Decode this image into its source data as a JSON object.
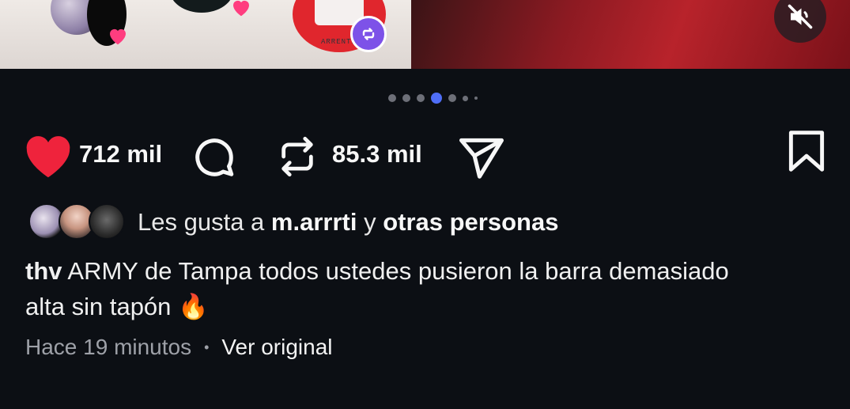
{
  "post": {
    "username": "thv",
    "caption": "ARMY de Tampa todos ustedes pusieron la barra demasiado alta sin tapón",
    "caption_emoji": "🔥",
    "time": "Hace 19 minutos",
    "separator": "•",
    "see_original": "Ver original"
  },
  "media": {
    "story_text": "ARRENTI",
    "current_slide": 4,
    "total_slides": 7
  },
  "actions": {
    "like_count": "712 mil",
    "repost_count": "85.3 mil"
  },
  "likes": {
    "prefix": "Les gusta a ",
    "user": "m.arrrti",
    "middle": " y ",
    "others": "otras personas"
  },
  "colors": {
    "background": "#0c0f14",
    "like": "#ef233c",
    "active_dot": "#4f6ef7",
    "repost_badge": "#7d52e8"
  },
  "icons": {
    "like": "heart-icon",
    "comment": "comment-icon",
    "repost": "repost-icon",
    "share": "send-icon",
    "save": "bookmark-icon",
    "mute": "speaker-muted-icon"
  }
}
